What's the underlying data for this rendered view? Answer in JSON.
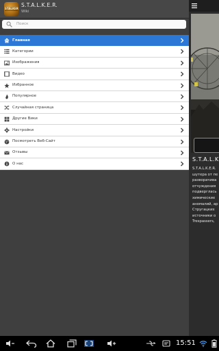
{
  "app": {
    "title": "S.T.A.L.K.E.R.",
    "subtitle": "Wiki",
    "logo_text": "STALKER"
  },
  "search": {
    "placeholder": "Поиск"
  },
  "menu": [
    {
      "label": "Главная",
      "icon": "home-icon",
      "active": true
    },
    {
      "label": "Категории",
      "icon": "list-icon",
      "active": false
    },
    {
      "label": "Изображения",
      "icon": "image-icon",
      "active": false
    },
    {
      "label": "Видео",
      "icon": "film-icon",
      "active": false
    },
    {
      "label": "Избранное",
      "icon": "star-icon",
      "active": false
    },
    {
      "label": "Популярное",
      "icon": "fire-icon",
      "active": false
    },
    {
      "label": "Случайная страница",
      "icon": "shuffle-icon",
      "active": false
    },
    {
      "label": "Другие Вики",
      "icon": "grid-icon",
      "active": false
    },
    {
      "label": "Настройки",
      "icon": "gear-icon",
      "active": false
    },
    {
      "label": "Посмотреть Веб-Сайт",
      "icon": "globe-icon",
      "active": false
    },
    {
      "label": "Отзывы",
      "icon": "mail-icon",
      "active": false
    },
    {
      "label": "О нас",
      "icon": "info-icon",
      "active": false
    }
  ],
  "content": {
    "title": "S.T.A.L.K.",
    "lines": [
      "S.T.A.L.K.E.R.",
      "шутера от пе",
      "разворачива",
      "отчуждения",
      "подверглась",
      "химические",
      "аномалий, ар",
      "Стругацких",
      "источники о",
      "Trespassers,"
    ]
  },
  "status": {
    "time": "15:51"
  },
  "colors": {
    "accent": "#2b78d6",
    "drawer_bg": "#3f3f3f",
    "header_bg": "#474747"
  }
}
